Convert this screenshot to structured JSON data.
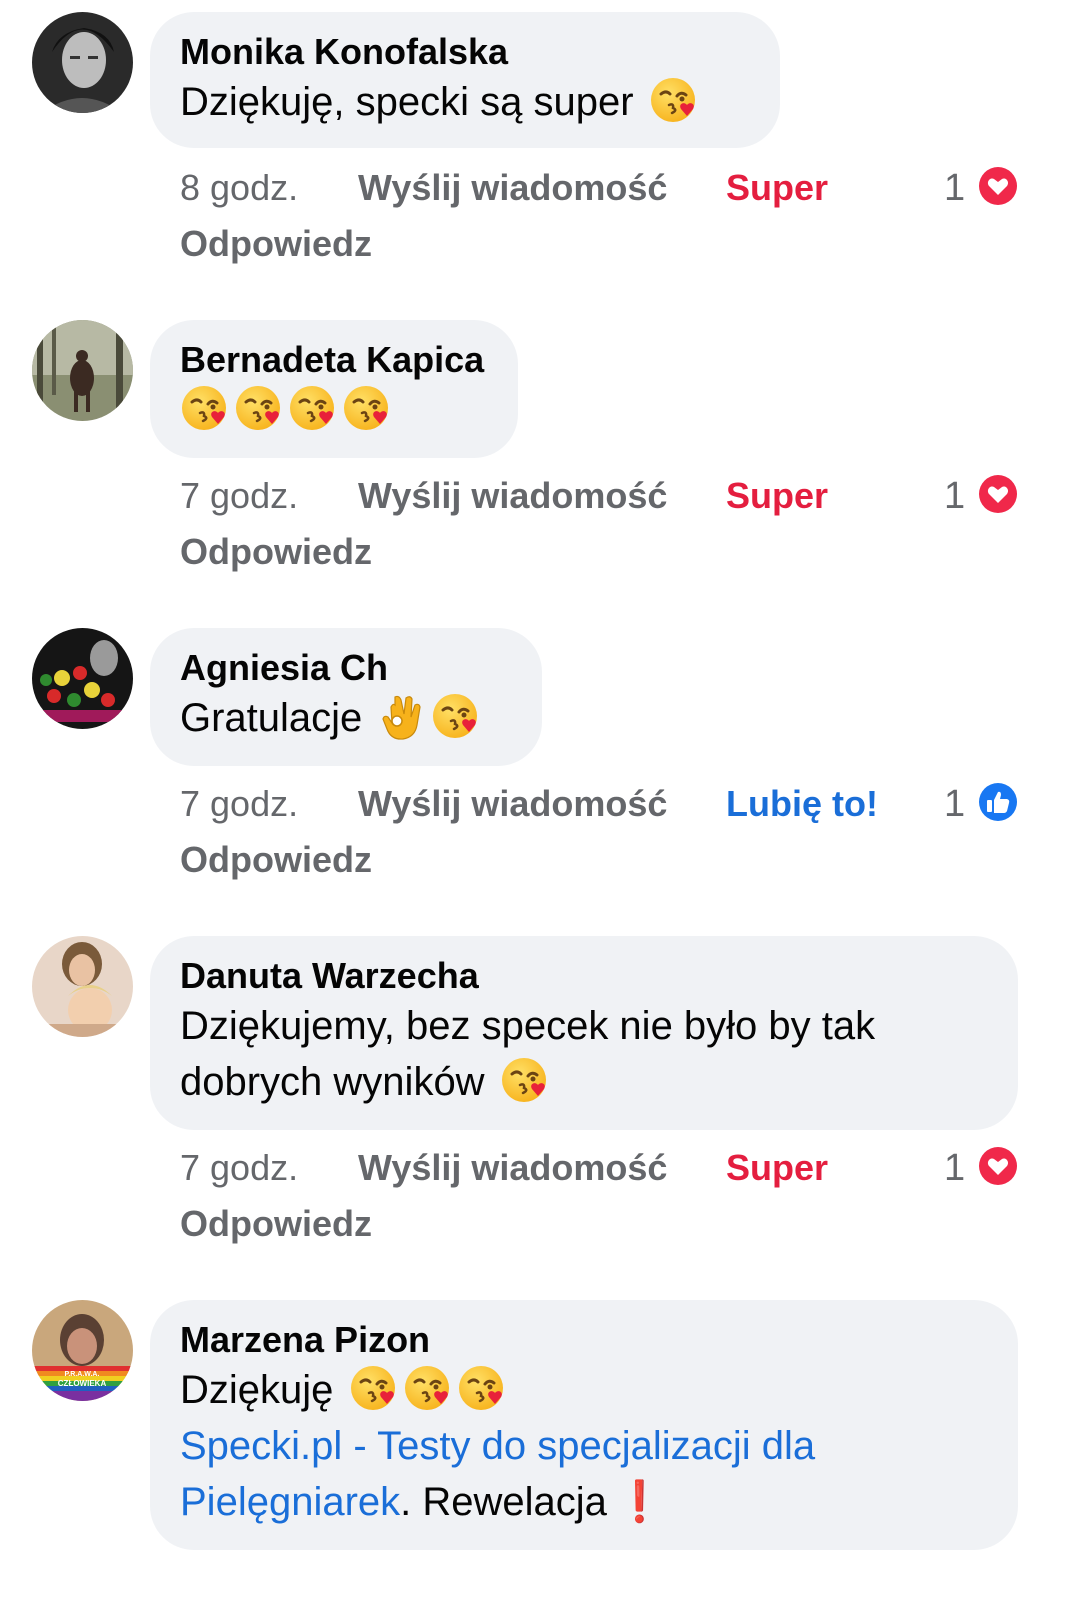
{
  "colors": {
    "love": "#e41e3f",
    "like": "#1a6ed8",
    "meta": "#65676b",
    "bubble": "#f0f2f5"
  },
  "comments": [
    {
      "author": "Monika Konofalska",
      "text": "Dziękuję, specki są super",
      "emojis": [
        "kissing-heart"
      ],
      "time": "8 godz.",
      "send": "Wyślij wiadomość",
      "reaction_label": "Super",
      "reply": "Odpowiedz",
      "reaction_count": "1",
      "reaction_icon": "heart-icon"
    },
    {
      "author": "Bernadeta Kapica",
      "text": "",
      "emojis": [
        "kissing-heart",
        "kissing-heart",
        "kissing-heart",
        "kissing-heart"
      ],
      "time": "7 godz.",
      "send": "Wyślij wiadomość",
      "reaction_label": "Super",
      "reply": "Odpowiedz",
      "reaction_count": "1",
      "reaction_icon": "heart-icon"
    },
    {
      "author": "Agniesia Ch",
      "text": "Gratulacje",
      "emojis": [
        "ok-hand",
        "kissing-heart"
      ],
      "time": "7 godz.",
      "send": "Wyślij wiadomość",
      "reaction_label": "Lubię to!",
      "reply": "Odpowiedz",
      "reaction_count": "1",
      "reaction_icon": "like-icon"
    },
    {
      "author": "Danuta Warzecha",
      "text_line1": "Dziękujemy, bez specek nie było by tak",
      "text_line2": "dobrych wyników",
      "emojis": [
        "kissing-heart"
      ],
      "time": "7 godz.",
      "send": "Wyślij wiadomość",
      "reaction_label": "Super",
      "reply": "Odpowiedz",
      "reaction_count": "1",
      "reaction_icon": "heart-icon"
    },
    {
      "author": "Marzena Pizon",
      "text": "Dziękuję",
      "emojis": [
        "kissing-heart",
        "kissing-heart",
        "kissing-heart"
      ],
      "link_line1": "Specki.pl - Testy do specjalizacji dla",
      "link_line2": "Pielęgniarek",
      "after_link": ". Rewelacja",
      "avatar_badge_line1": "P.R.A.W.A.",
      "avatar_badge_line2": "CZŁOWIEKA"
    }
  ]
}
